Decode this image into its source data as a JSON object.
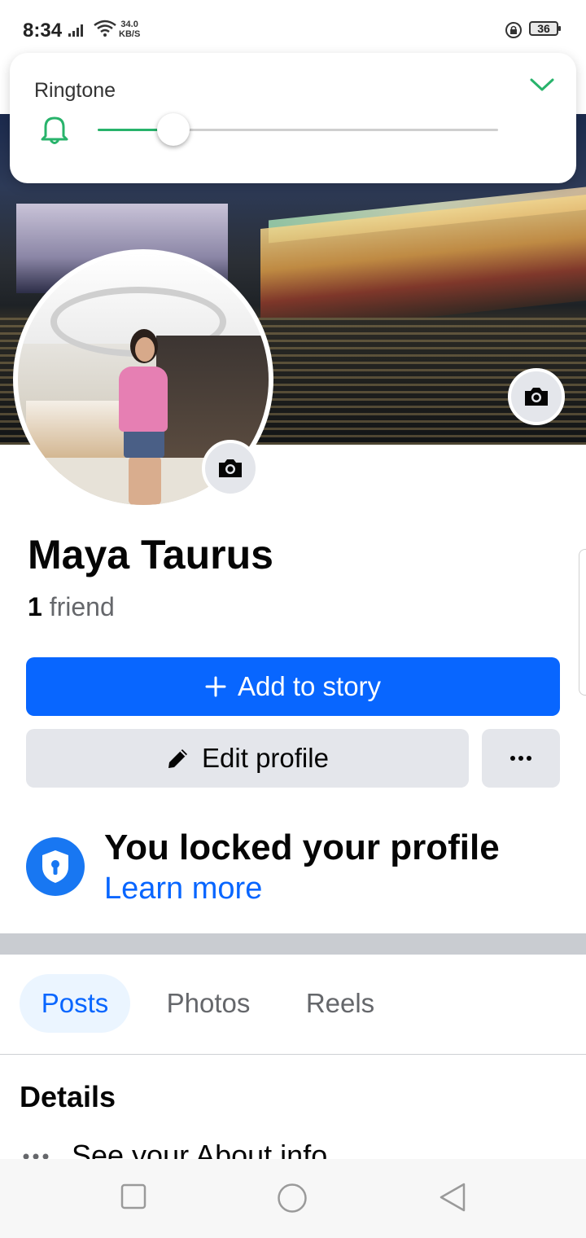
{
  "status_bar": {
    "time": "8:34",
    "net_speed_value": "34.0",
    "net_speed_unit": "KB/S",
    "battery": "36"
  },
  "ringtone_panel": {
    "label": "Ringtone",
    "volume_fraction": 0.19,
    "accent_color": "#28b36b"
  },
  "profile": {
    "name": "Maya Taurus",
    "friend_count": "1",
    "friend_label": "friend"
  },
  "actions": {
    "add_story": "Add to story",
    "edit_profile": "Edit profile"
  },
  "lock_notice": {
    "title": "You locked your profile",
    "link": "Learn more"
  },
  "tabs": [
    {
      "label": "Posts",
      "active": true
    },
    {
      "label": "Photos",
      "active": false
    },
    {
      "label": "Reels",
      "active": false
    }
  ],
  "details": {
    "heading": "Details",
    "about_row": "See your About info"
  },
  "colors": {
    "brand_blue": "#0866ff",
    "button_gray": "#e4e6eb"
  }
}
